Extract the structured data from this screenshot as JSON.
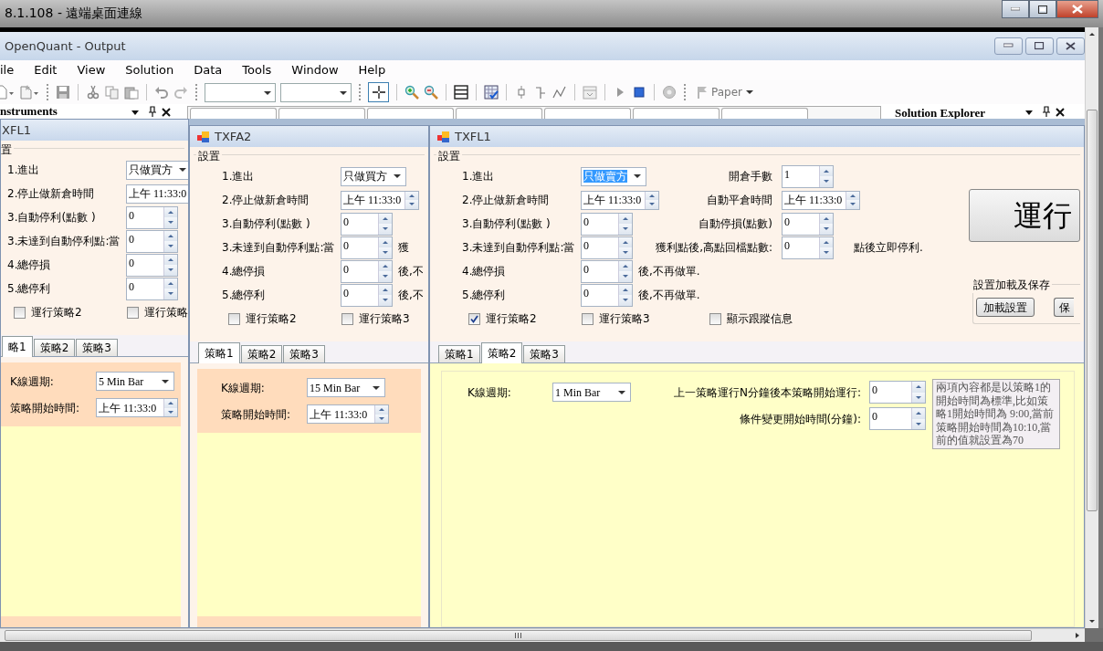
{
  "remote_window": {
    "title": "8.1.108 - 遠端桌面連線"
  },
  "app_window": {
    "title": "OpenQuant - Output"
  },
  "menu": [
    "ile",
    "Edit",
    "View",
    "Solution",
    "Data",
    "Tools",
    "Window",
    "Help"
  ],
  "toolbar": {
    "cursor_tool_on": true,
    "profile": "Paper"
  },
  "panes": {
    "left_title": "nstruments",
    "right_title": "Solution Explorer"
  },
  "windows": [
    {
      "title": "XFL1",
      "icon": false,
      "group_label": "置",
      "rows": [
        {
          "label": "1.進出",
          "kind": "combo",
          "value": "只做買方",
          "highlighted": false
        },
        {
          "label": "2.停止做新倉時間",
          "kind": "time",
          "value": "上午 11:33:0"
        },
        {
          "label": "3.自動停利(點數 )",
          "kind": "spin",
          "value": "0"
        },
        {
          "label": "3.未達到自動停利點:當",
          "kind": "spin",
          "value": "0"
        },
        {
          "label": "4.總停損",
          "kind": "spin",
          "value": "0"
        },
        {
          "label": "5.總停利",
          "kind": "spin",
          "value": "0"
        }
      ],
      "checks": [
        {
          "label": "運行策略2",
          "checked": false
        },
        {
          "label": "運行策略",
          "checked": false
        }
      ],
      "tabs": [
        {
          "label": "略1",
          "selected": true
        },
        {
          "label": "策略2",
          "selected": false
        },
        {
          "label": "策略3",
          "selected": false
        }
      ],
      "page": {
        "fields": [
          {
            "label": "K線週期:",
            "kind": "combo",
            "value": "5 Min Bar"
          },
          {
            "label": "策略開始時間:",
            "kind": "time",
            "value": "上午 11:33:0"
          }
        ]
      }
    },
    {
      "title": "TXFA2",
      "icon": true,
      "group_label": "設置",
      "rows": [
        {
          "label": "1.進出",
          "kind": "combo",
          "value": "只做買方",
          "highlighted": false
        },
        {
          "label": "2.停止做新倉時間",
          "kind": "time",
          "value": "上午 11:33:0"
        },
        {
          "label": "3.自動停利(點數 )",
          "kind": "spin",
          "value": "0"
        },
        {
          "label": "3.未達到自動停利點:當",
          "kind": "spin",
          "value": "0",
          "extra": {
            "label": "獲"
          }
        },
        {
          "label": "4.總停損",
          "kind": "spin",
          "value": "0",
          "suffix": "後,不"
        },
        {
          "label": "5.總停利",
          "kind": "spin",
          "value": "0",
          "suffix": "後,不"
        }
      ],
      "checks": [
        {
          "label": "運行策略2",
          "checked": false
        },
        {
          "label": "運行策略3",
          "checked": false
        }
      ],
      "tabs": [
        {
          "label": "策略1",
          "selected": true
        },
        {
          "label": "策略2",
          "selected": false
        },
        {
          "label": "策略3",
          "selected": false
        }
      ],
      "page": {
        "fields": [
          {
            "label": "K線週期:",
            "kind": "combo",
            "value": "15 Min Bar"
          },
          {
            "label": "策略開始時間:",
            "kind": "time",
            "value": "上午 11:33:0"
          }
        ]
      }
    },
    {
      "title": "TXFL1",
      "icon": true,
      "group_label": "設置",
      "rows": [
        {
          "label": "1.進出",
          "kind": "combo",
          "value": "只做賣方",
          "highlighted": true,
          "extra": {
            "label": "開倉手數",
            "kind": "spin",
            "value": "1"
          }
        },
        {
          "label": "2.停止做新倉時間",
          "kind": "time",
          "value": "上午 11:33:0",
          "extra": {
            "label": "自動平倉時間",
            "kind": "time",
            "value": "上午 11:33:0"
          }
        },
        {
          "label": "3.自動停利(點數 )",
          "kind": "spin",
          "value": "0",
          "extra": {
            "label": "自動停損(點數)",
            "kind": "spin",
            "value": "0"
          }
        },
        {
          "label": "3.未達到自動停利點:當",
          "kind": "spin",
          "value": "0",
          "extra": {
            "label": "獲利點後,高點回檔點數:",
            "kind": "spin",
            "value": "0",
            "suffix": "點後立即停利."
          }
        },
        {
          "label": "4.總停損",
          "kind": "spin",
          "value": "0",
          "suffix": "後,不再做單."
        },
        {
          "label": "5.總停利",
          "kind": "spin",
          "value": "0",
          "suffix": "後,不再做單."
        }
      ],
      "checks": [
        {
          "label": "運行策略2",
          "checked": true
        },
        {
          "label": "運行策略3",
          "checked": false
        },
        {
          "label": "顯示跟蹤信息",
          "checked": false
        }
      ],
      "run_button": "運行",
      "storage": {
        "title": "設置加載及保存",
        "buttons": [
          "加載設置",
          "保"
        ]
      },
      "tabs": [
        {
          "label": "策略1",
          "selected": false
        },
        {
          "label": "策略2",
          "selected": true
        },
        {
          "label": "策略3",
          "selected": false
        }
      ],
      "page": {
        "fields": [
          {
            "label": "K線週期:",
            "kind": "combo",
            "value": "1 Min Bar"
          }
        ],
        "side_fields": [
          {
            "label": "上一策略運行N分鐘後本策略開始運行:",
            "kind": "spin",
            "value": "0"
          },
          {
            "label": "條件變更開始時間(分鐘):",
            "kind": "spin",
            "value": "0"
          }
        ],
        "note": "兩項內容都是以策略1的開始時間為標準,比如策略1開始時間為 9:00,當前策略開始時間為10:10,當前的值就設置為70"
      }
    }
  ]
}
